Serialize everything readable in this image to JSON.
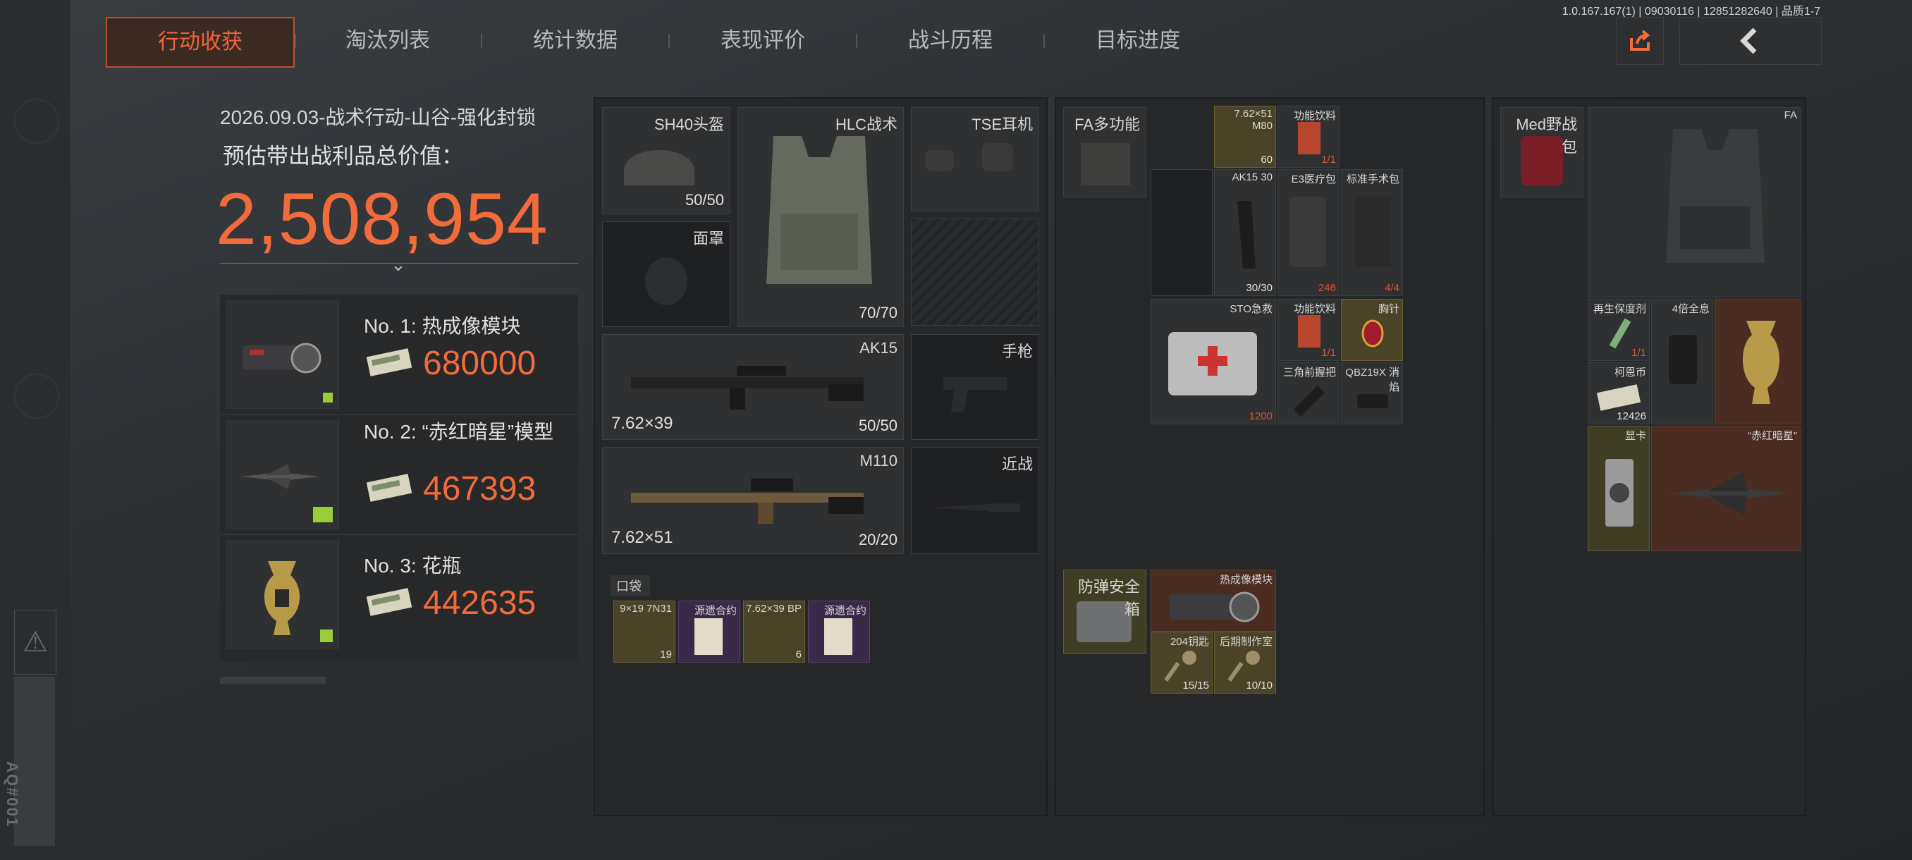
{
  "version": "1.0.167.167(1) | 09030116 | 12851282640 | 品质1-7",
  "tabs": [
    {
      "label": "行动收获",
      "active": true
    },
    {
      "label": "淘汰列表"
    },
    {
      "label": "统计数据"
    },
    {
      "label": "表现评价"
    },
    {
      "label": "战斗历程"
    },
    {
      "label": "目标进度"
    }
  ],
  "side_badge": "AQ#001",
  "summary": {
    "title": "2026.09.03-战术行动-山谷-强化封锁",
    "value_label": "预估带出战利品总价值：",
    "total_value": "2,508,954"
  },
  "top_items": [
    {
      "name": "No. 1: 热成像模块",
      "value": "680000"
    },
    {
      "name": "No. 2: “赤红暗星”模型",
      "value": "467393"
    },
    {
      "name": "No. 3: 花瓶",
      "value": "442635"
    }
  ],
  "equipment": {
    "helmet": {
      "label": "SH40头盔",
      "count": "50/50"
    },
    "armor": {
      "label": "HLC战术",
      "count": "70/70"
    },
    "earpiece": {
      "label": "TSE耳机"
    },
    "mask": {
      "label": "面罩"
    },
    "weapon1": {
      "label": "AK15",
      "caliber": "7.62×39",
      "ammo": "50/50"
    },
    "pistol": {
      "label": "手枪"
    },
    "weapon2": {
      "label": "M110",
      "caliber": "7.62×51",
      "ammo": "20/20"
    },
    "melee": {
      "label": "近战"
    },
    "pocket_label": "口袋",
    "pocket": [
      {
        "label": "9×19 7N31",
        "count": "19"
      },
      {
        "label": "源遗合约",
        "count": ""
      },
      {
        "label": "7.62×39 BP",
        "count": "6"
      },
      {
        "label": "源遗合约",
        "count": ""
      }
    ]
  },
  "rig": {
    "label": "FA多功能",
    "items": [
      {
        "label": "7.62×51 M80",
        "count": "60"
      },
      {
        "label": "功能饮料",
        "count": "1/1"
      },
      {
        "label": "AK15 30",
        "count": "30/30"
      },
      {
        "label": "E3医疗包",
        "count": "246"
      },
      {
        "label": "标准手术包",
        "count": "4/4"
      },
      {
        "label": "STO急救",
        "count": "1200"
      },
      {
        "label": "功能饮料",
        "count": "1/1"
      },
      {
        "label": "胸针",
        "count": ""
      },
      {
        "label": "三角前握把",
        "count": ""
      },
      {
        "label": "QBZ19X 消焰",
        "count": ""
      }
    ],
    "safe_box": {
      "label": "防弹安全箱"
    },
    "safe_items": [
      {
        "label": "热成像模块",
        "count": ""
      },
      {
        "label": "204钥匙",
        "count": "15/15"
      },
      {
        "label": "后期制作室",
        "count": "10/10"
      }
    ]
  },
  "backpack": {
    "label": "Med野战包",
    "vest_label": "FA",
    "items": [
      {
        "label": "再生保度剂",
        "count": "1/1"
      },
      {
        "label": "4倍全息",
        "count": ""
      },
      {
        "label": "柯恩币",
        "count": "12426"
      },
      {
        "label": "显卡",
        "count": ""
      },
      {
        "label": "“赤红暗星”",
        "count": ""
      }
    ]
  },
  "colors": {
    "accent": "#f26b3a",
    "panel": "#252729",
    "gold_slot": "#4a4328",
    "purple_slot": "#3a2a48"
  }
}
